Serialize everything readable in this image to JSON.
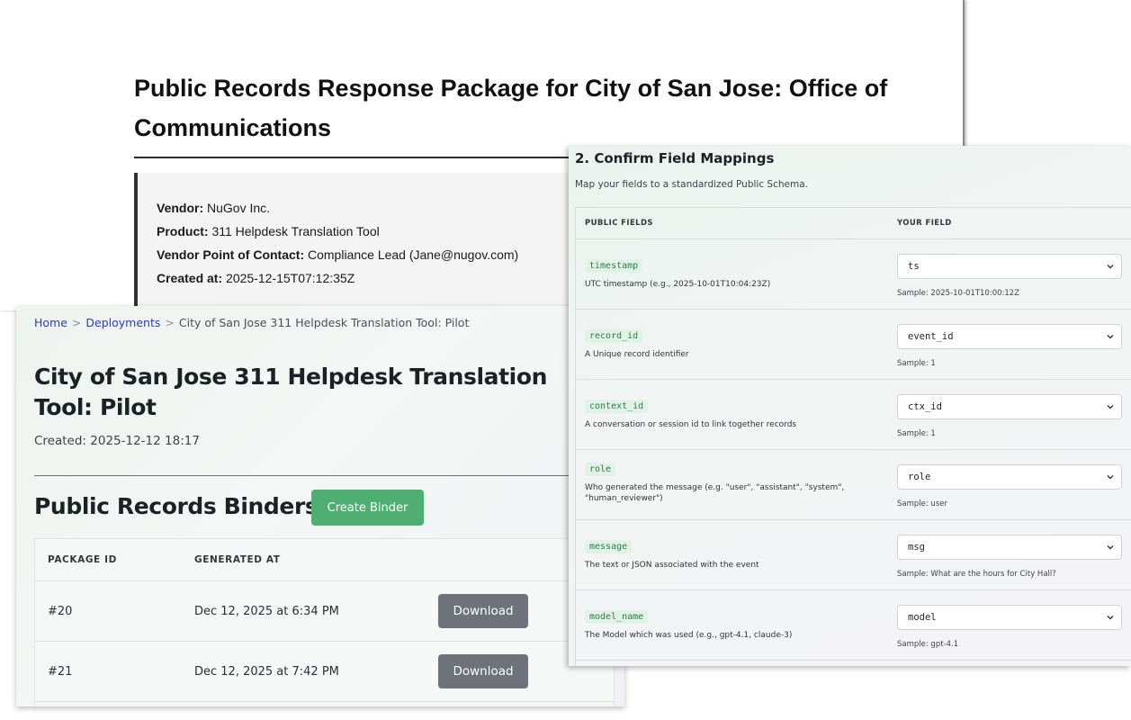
{
  "document": {
    "title": "Public Records Response Package for City of San Jose: Office of Communications",
    "meta": [
      {
        "label": "Vendor:",
        "value": "NuGov Inc."
      },
      {
        "label": "Product:",
        "value": "311 Helpdesk Translation Tool"
      },
      {
        "label": "Vendor Point of Contact:",
        "value": "Compliance Lead (Jane@nugov.com)"
      },
      {
        "label": "Created at:",
        "value": "2025-12-15T07:12:35Z"
      }
    ]
  },
  "deployment": {
    "breadcrumb": {
      "home": "Home",
      "deployments": "Deployments",
      "current": "City of San Jose 311 Helpdesk Translation Tool: Pilot",
      "separator": ">"
    },
    "title": "City of San Jose 311 Helpdesk Translation Tool: Pilot",
    "created": "Created: 2025-12-12 18:17",
    "binders_heading": "Public Records Binders",
    "create_binder_label": "Create Binder",
    "table": {
      "headers": [
        "PACKAGE ID",
        "GENERATED AT"
      ],
      "rows": [
        {
          "id": "#20",
          "generated": "Dec 12, 2025 at 6:34 PM",
          "action": "Download"
        },
        {
          "id": "#21",
          "generated": "Dec 12, 2025 at 7:42 PM",
          "action": "Download"
        }
      ]
    }
  },
  "mapping": {
    "title": "2. Confirm Field Mappings",
    "subtitle": "Map your fields to a standardized Public Schema.",
    "headers": {
      "public": "PUBLIC FIELDS",
      "yours": "YOUR FIELD"
    },
    "rows": [
      {
        "field": "timestamp",
        "description": "UTC timestamp (e.g., 2025-10-01T10:04:23Z)",
        "selected": "ts",
        "sample": "Sample: 2025-10-01T10:00:12Z"
      },
      {
        "field": "record_id",
        "description": "A Unique record identifier",
        "selected": "event_id",
        "sample": "Sample: 1"
      },
      {
        "field": "context_id",
        "description": "A conversation or session id to link together records",
        "selected": "ctx_id",
        "sample": "Sample: 1"
      },
      {
        "field": "role",
        "description": "Who generated the message (e.g. \"user\", \"assistant\", \"system\", \"human_reviewer\")",
        "selected": "role",
        "sample": "Sample: user"
      },
      {
        "field": "message",
        "description": "The text or JSON associated with the event",
        "selected": "msg",
        "sample": "Sample: What are the hours for City Hall?"
      },
      {
        "field": "model_name",
        "description": "The Model which was used (e.g., gpt-4.1, claude-3)",
        "selected": "model",
        "sample": "Sample: gpt-4.1"
      }
    ]
  }
}
